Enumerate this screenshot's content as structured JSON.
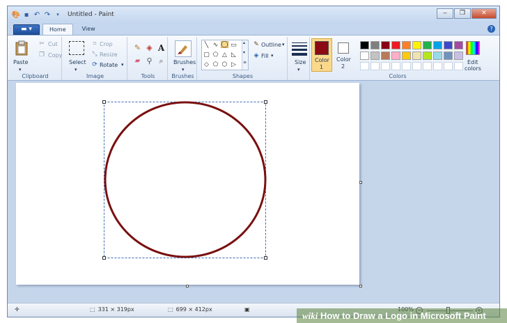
{
  "titlebar": {
    "title": "Untitled - Paint",
    "buttons": [
      "minimize-icon",
      "restore-icon",
      "close-icon"
    ]
  },
  "tabs": {
    "home": "Home",
    "view": "View"
  },
  "clipboard": {
    "paste": "Paste",
    "cut": "Cut",
    "copy": "Copy",
    "label": "Clipboard"
  },
  "image": {
    "select": "Select",
    "crop": "Crop",
    "resize": "Resize",
    "rotate": "Rotate",
    "label": "Image"
  },
  "tools": {
    "label": "Tools"
  },
  "brushes": {
    "label": "Brushes"
  },
  "shapes": {
    "outline": "Outline",
    "fill": "Fill",
    "label": "Shapes"
  },
  "size": {
    "label": "Size"
  },
  "color1": {
    "label": "Color",
    "num": "1",
    "value": "#8b0a14"
  },
  "color2": {
    "label": "Color",
    "num": "2",
    "value": "#ffffff"
  },
  "colors": {
    "label": "Colors",
    "edit_line1": "Edit",
    "edit_line2": "colors",
    "palette_row1": [
      "#000000",
      "#7f7f7f",
      "#880015",
      "#ed1c24",
      "#ff7f27",
      "#fff200",
      "#22b14c",
      "#00a2e8",
      "#3f48cc",
      "#a349a4"
    ],
    "palette_row2": [
      "#ffffff",
      "#c3c3c3",
      "#b97a57",
      "#ffaec9",
      "#ffc90e",
      "#efe4b0",
      "#b5e61d",
      "#99d9ea",
      "#7092be",
      "#c8bfe7"
    ]
  },
  "canvas": {
    "shape": "circle",
    "stroke_color": "#7a1010",
    "background": "#ffffff"
  },
  "statusbar": {
    "selection_size": "331 × 319px",
    "canvas_size": "699 × 412px",
    "zoom": "100%"
  },
  "watermark": {
    "brand": "wiki",
    "text": "How to Draw a Logo in Microsoft Paint"
  }
}
